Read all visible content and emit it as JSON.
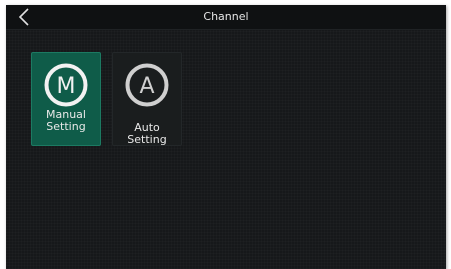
{
  "header": {
    "title": "Channel",
    "back_icon": "chevron-left-icon"
  },
  "options": [
    {
      "icon_letter": "M",
      "label_line1": "Manual",
      "label_line2": "Setting",
      "selected": true,
      "color": "#0f5c49"
    },
    {
      "icon_letter": "A",
      "label": "Auto Setting",
      "selected": false,
      "color": "#1a1d1e"
    }
  ]
}
